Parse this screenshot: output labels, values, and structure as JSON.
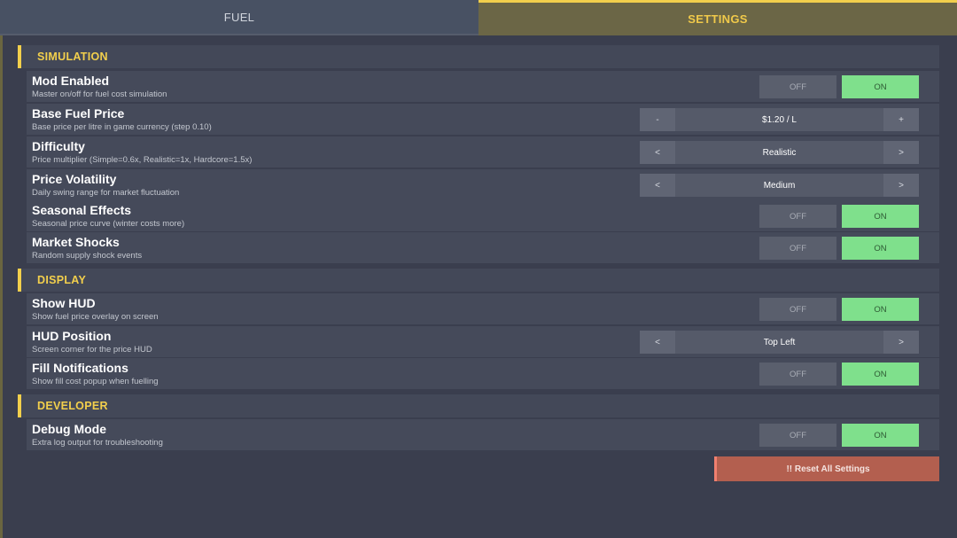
{
  "tabs": [
    {
      "label": "FUEL",
      "active": false
    },
    {
      "label": "SETTINGS",
      "active": true
    }
  ],
  "sections": {
    "simulation": "SIMULATION",
    "display": "DISPLAY",
    "developer": "DEVELOPER"
  },
  "settings": {
    "mod_enabled": {
      "name": "Mod Enabled",
      "desc": "Master on/off for fuel cost simulation",
      "off": "OFF",
      "on": "ON",
      "value": "ON"
    },
    "base_fuel_price": {
      "name": "Base Fuel Price",
      "desc": "Base price per litre in game currency (step 0.10)",
      "prev": "-",
      "next": "+",
      "value": "$1.20 / L"
    },
    "difficulty": {
      "name": "Difficulty",
      "desc": "Price multiplier (Simple=0.6x, Realistic=1x, Hardcore=1.5x)",
      "prev": "<",
      "next": ">",
      "value": "Realistic"
    },
    "price_volatility": {
      "name": "Price Volatility",
      "desc": "Daily swing range for market fluctuation",
      "prev": "<",
      "next": ">",
      "value": "Medium"
    },
    "seasonal_effects": {
      "name": "Seasonal Effects",
      "desc": "Seasonal price curve (winter costs more)",
      "off": "OFF",
      "on": "ON",
      "value": "ON"
    },
    "market_shocks": {
      "name": "Market Shocks",
      "desc": "Random supply shock events",
      "off": "OFF",
      "on": "ON",
      "value": "ON"
    },
    "show_hud": {
      "name": "Show HUD",
      "desc": "Show fuel price overlay on screen",
      "off": "OFF",
      "on": "ON",
      "value": "ON"
    },
    "hud_position": {
      "name": "HUD Position",
      "desc": "Screen corner for the price HUD",
      "prev": "<",
      "next": ">",
      "value": "Top Left"
    },
    "fill_notifications": {
      "name": "Fill Notifications",
      "desc": "Show fill cost popup when fuelling",
      "off": "OFF",
      "on": "ON",
      "value": "ON"
    },
    "debug_mode": {
      "name": "Debug Mode",
      "desc": "Extra log output for troubleshooting",
      "off": "OFF",
      "on": "ON",
      "value": "ON"
    }
  },
  "reset_button": "!! Reset All Settings",
  "colors": {
    "accent_yellow": "#f2cf4c",
    "on_green": "#7fe08c",
    "reset_red": "#b35f4f",
    "panel_bg": "#3a3e4e"
  }
}
